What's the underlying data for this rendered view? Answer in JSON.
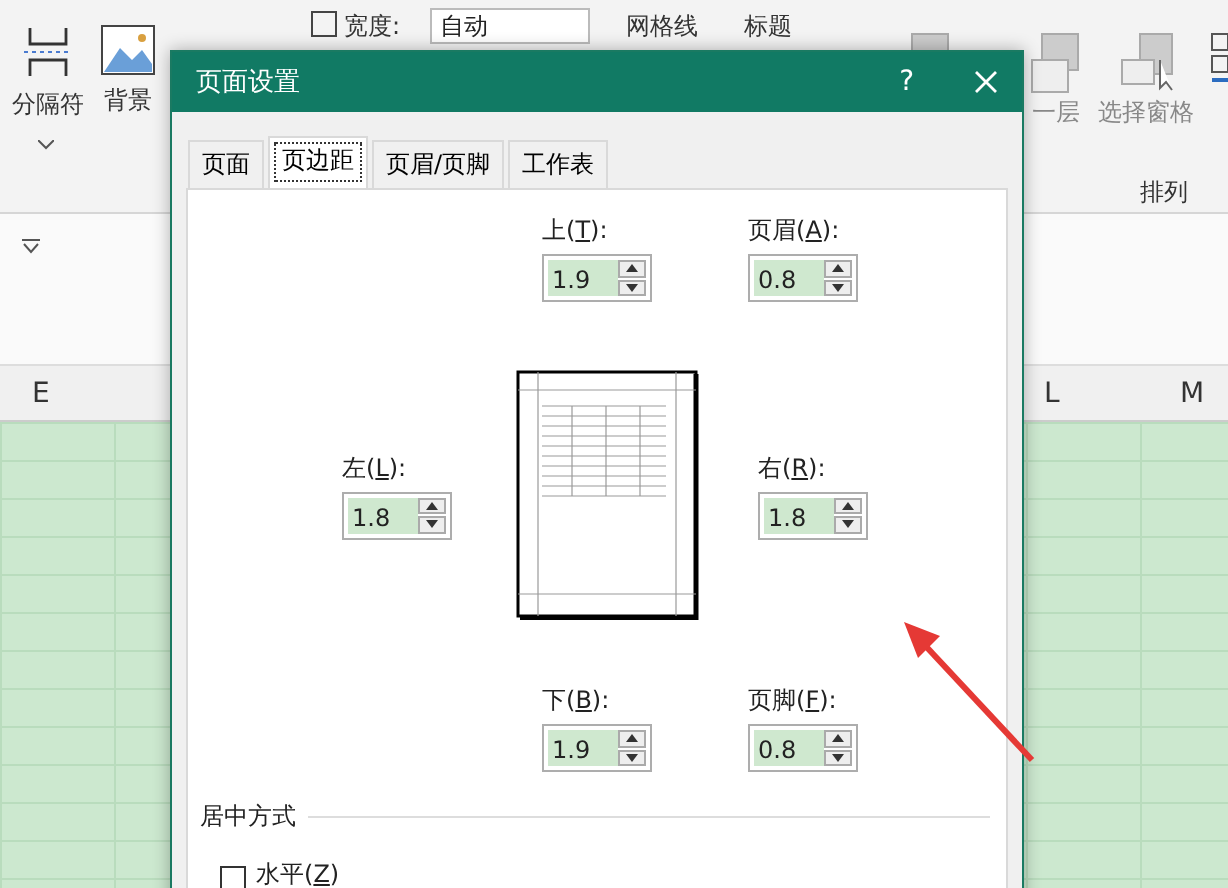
{
  "ribbon": {
    "buttons": [
      {
        "label": "分隔符"
      },
      {
        "label": "背景"
      }
    ],
    "width_label": "宽度:",
    "width_value": "自动",
    "gridlines_label": "网格线",
    "headings_label": "标题",
    "arrange_buttons": [
      {
        "label": "一层"
      },
      {
        "label": "选择窗格"
      }
    ],
    "group_label": "排列"
  },
  "columns": [
    {
      "label": "E"
    },
    {
      "label": "L"
    },
    {
      "label": "M"
    }
  ],
  "dialog": {
    "title": "页面设置",
    "help": "?",
    "tabs": [
      {
        "label": "页面",
        "selected": false
      },
      {
        "label": "页边距",
        "selected": true
      },
      {
        "label": "页眉/页脚",
        "selected": false
      },
      {
        "label": "工作表",
        "selected": false
      }
    ],
    "margins": {
      "top": {
        "label": [
          "上(",
          "T",
          "):"
        ],
        "value": "1.9"
      },
      "header": {
        "label": [
          "页眉(",
          "A",
          "):"
        ],
        "value": "0.8"
      },
      "left": {
        "label": [
          "左(",
          "L",
          "):"
        ],
        "value": "1.8"
      },
      "right": {
        "label": [
          "右(",
          "R",
          "):"
        ],
        "value": "1.8"
      },
      "bottom": {
        "label": [
          "下(",
          "B",
          "):"
        ],
        "value": "1.9"
      },
      "footer": {
        "label": [
          "页脚(",
          "F",
          "):"
        ],
        "value": "0.8"
      }
    },
    "center": {
      "title": "居中方式",
      "options": [
        {
          "label": [
            "水平(",
            "Z",
            ")"
          ],
          "checked": false
        }
      ]
    }
  }
}
